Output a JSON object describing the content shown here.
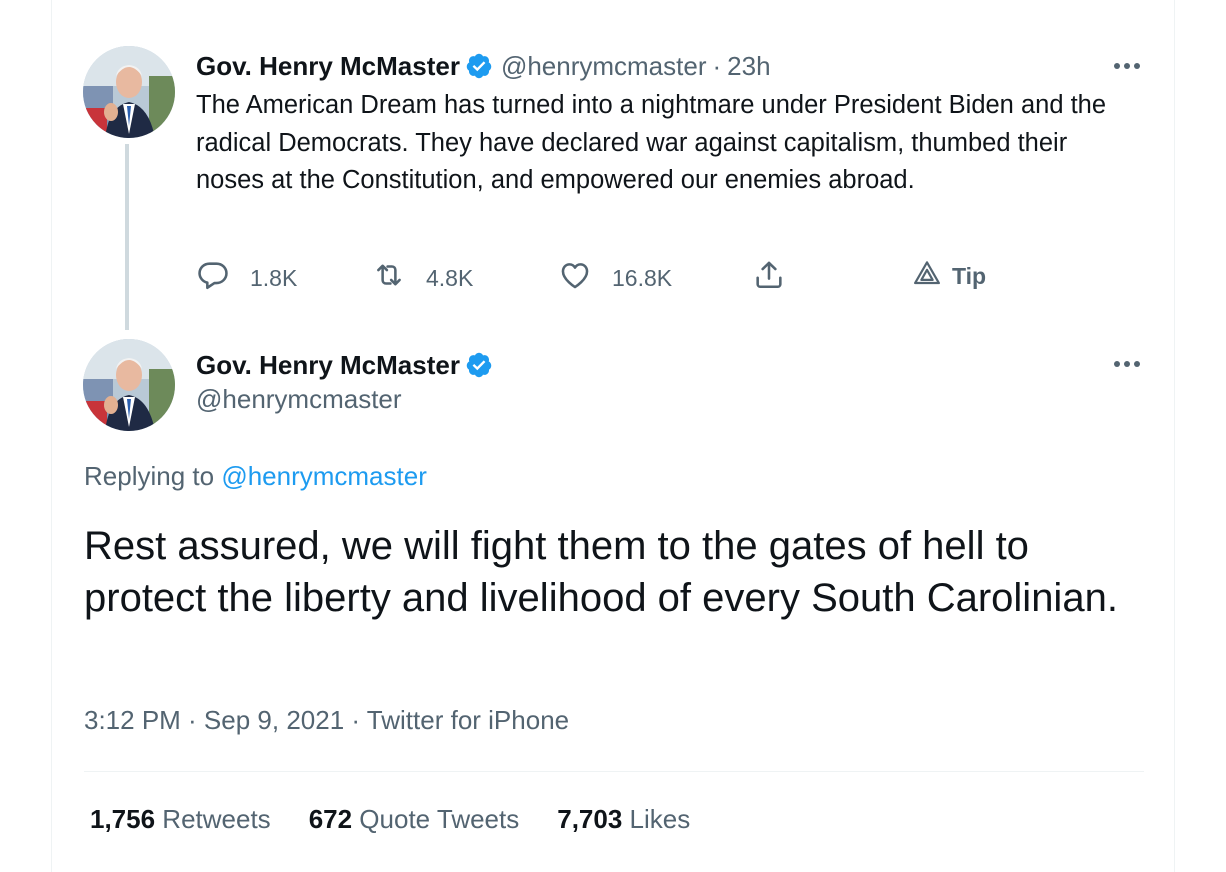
{
  "original_tweet": {
    "display_name": "Gov. Henry McMaster",
    "handle": "@henrymcmaster",
    "separator": "·",
    "time_ago": "23h",
    "text": "The American Dream has turned into a nightmare under President Biden and the radical Democrats. They have declared war against capitalism, thumbed their noses at the Constitution, and empowered our enemies abroad.",
    "actions": {
      "reply_count": "1.8K",
      "retweet_count": "4.8K",
      "like_count": "16.8K",
      "tip_label": "Tip"
    }
  },
  "main_tweet": {
    "display_name": "Gov. Henry McMaster",
    "handle": "@henrymcmaster",
    "replying_prefix": "Replying to",
    "replying_to": "@henrymcmaster",
    "text": "Rest assured, we will fight them to the gates of hell to protect the liberty and livelihood of every South Carolinian.",
    "timestamp": "3:12 PM · Sep 9, 2021 · Twitter for iPhone",
    "stats": {
      "retweets_count": "1,756",
      "retweets_label": "Retweets",
      "quotes_count": "672",
      "quotes_label": "Quote Tweets",
      "likes_count": "7,703",
      "likes_label": "Likes"
    }
  },
  "icons": {
    "verified": "verified-badge-icon",
    "reply": "reply-icon",
    "retweet": "retweet-icon",
    "like": "heart-icon",
    "share": "share-icon",
    "tip": "tip-icon",
    "more": "more-options-icon"
  },
  "colors": {
    "accent": "#1d9bf0",
    "text_primary": "#0f1419",
    "text_secondary": "#536471",
    "thread_line": "#cfd9de",
    "divider": "#eff3f4"
  }
}
